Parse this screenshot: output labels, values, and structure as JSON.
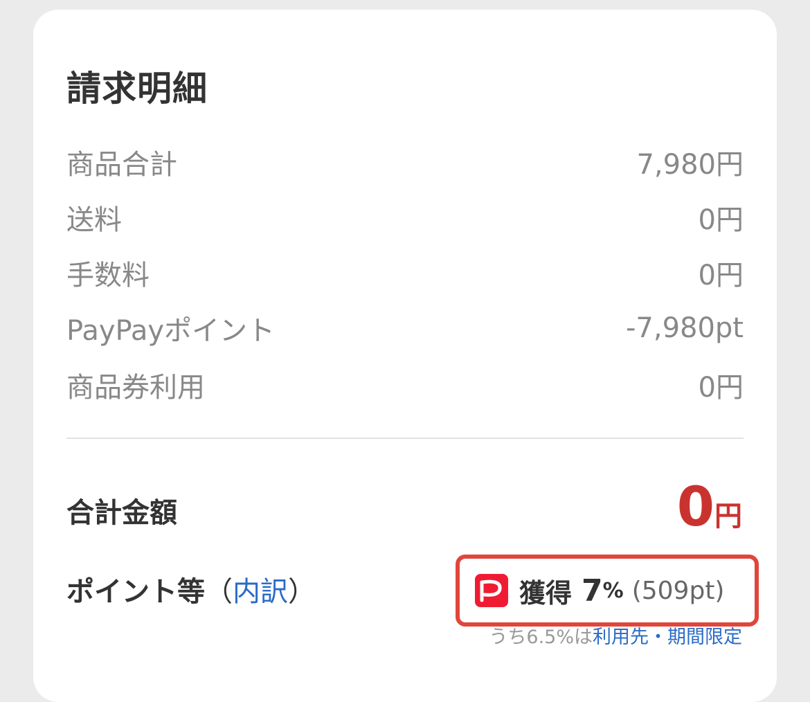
{
  "card": {
    "title": "請求明細",
    "rows": [
      {
        "label": "商品合計",
        "value": "7,980円"
      },
      {
        "label": "送料",
        "value": "0円"
      },
      {
        "label": "手数料",
        "value": "0円"
      },
      {
        "label": "PayPayポイント",
        "value": "-7,980pt"
      },
      {
        "label": "商品券利用",
        "value": "0円"
      }
    ],
    "total": {
      "label": "合計金額",
      "amount": "0",
      "unit": "円"
    },
    "points": {
      "label": "ポイント等",
      "paren_open": "（",
      "link": "内訳",
      "paren_close": "）",
      "logo_icon": "paypay-logo-icon",
      "earn_label": "獲得",
      "earn_rate": "7",
      "earn_rate_unit": "%",
      "earn_points": "(509pt)"
    },
    "footnote": {
      "prefix": "うち6.5%は",
      "link": "利用先・期間限定"
    }
  },
  "colors": {
    "accent_red": "#c9332f",
    "link_blue": "#2a6bc7",
    "highlight_border": "#e0463b",
    "paypay_red": "#ef1b33"
  }
}
